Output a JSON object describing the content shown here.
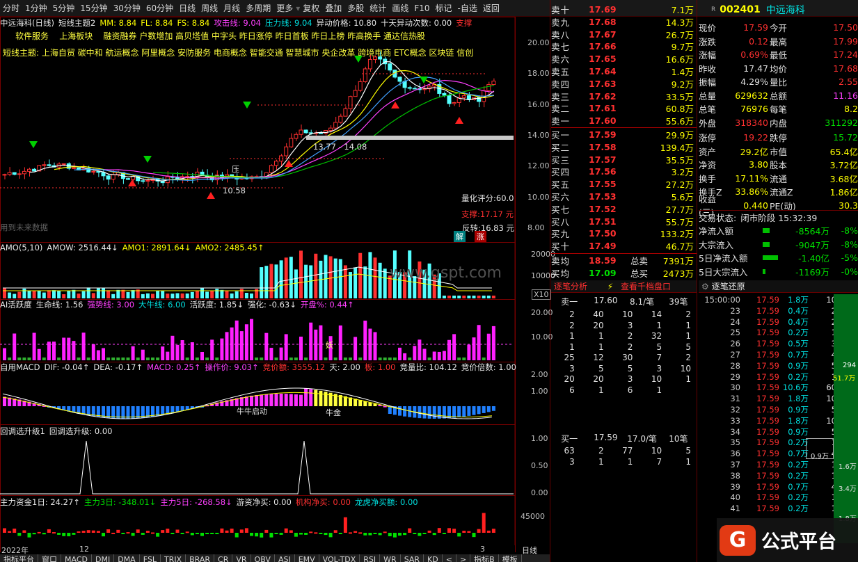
{
  "toolbar": [
    "分时",
    "1分钟",
    "5分钟",
    "15分钟",
    "30分钟",
    "60分钟",
    "日线",
    "周线",
    "月线",
    "多周期",
    "更多",
    "复权",
    "叠加",
    "多股",
    "统计",
    "画线",
    "F10",
    "标记",
    "-自选",
    "返回"
  ],
  "main_header": {
    "name": "中远海科(日线)",
    "ind": "短线主题2",
    "mm": "MM: 8.84",
    "fl": "FL: 8.84",
    "fs": "FS: 8.84",
    "gj": "攻击线: 9.04",
    "zj": "压力线: 9.04",
    "yd": "异动价格: 10.80",
    "ydcs": "十天异动次数: 0.00",
    "zc": "支撑"
  },
  "topics1": "软件服务    上海板块    融资融券 户数增加 高贝塔值 中字头 昨日涨停 昨日首板 昨日上榜 昨高换手 通达信热股",
  "topics2": "短线主题: 上海自贸 碳中和 航运概念 阿里概念 安防服务 电商概念 智能交通 智慧城市 央企改革 跨境电商 ETC概念 区块链 信创",
  "main_annot": {
    "range": "13.77 - 14.08",
    "low": "10.58",
    "score": "量化评分:60.0",
    "support": "支撑:17.17 元",
    "reverse": "反转:16.83 元",
    "future": "用到未来数据",
    "jie": "解",
    "zhang": "涨",
    "ya": "压"
  },
  "main_axis": [
    "20.00",
    "18.00",
    "16.00",
    "14.00",
    "12.00",
    "10.00",
    "8.00"
  ],
  "amo": {
    "t": "AMO(5,10)",
    "a": "AMOW: 2516.44↓",
    "b": "AMO1: 2891.64↓",
    "c": "AMO2: 2485.45↑",
    "axis": [
      "20000",
      "10000"
    ],
    "x10": "X10",
    "watermark": "www.gspt.com"
  },
  "ai": {
    "t": "AI活跃度",
    "a": "生命线: 1.56",
    "b": "强势线: 3.00",
    "c": "大牛线: 6.00",
    "d": "活跃度: 1.85↓",
    "e": "强化: -0.63↓",
    "f": "开盘%: 0.44↑",
    "axis": [
      "20.00",
      "10.00"
    ],
    "yao": "妖"
  },
  "macd": {
    "t": "自用MACD",
    "a": "DIF: -0.04↑",
    "b": "DEA: -0.17↑",
    "c": "MACD: 0.25↑",
    "d": "操作价: 9.03↑",
    "e": "竞价额: 3555.12",
    "f": "天: 2.00",
    "g": "板: 1.00",
    "h": "竞量比: 104.12",
    "i": "竞价倍数: 1.00",
    "axis": [
      "2.00",
      "1.00"
    ],
    "s1": "牛牛启动",
    "s2": "牛金"
  },
  "hd": {
    "t": "回调选升级1",
    "a": "回调选升级: 0.00",
    "axis": [
      "1.00",
      "0.50",
      "0.00"
    ]
  },
  "zl": {
    "t": "主力资金1日: 24.27↑",
    "a": "主力3日: -348.01↓",
    "b": "主力5日: -268.58↓",
    "c": "游资净买: 0.00",
    "d": "机构净买: 0.00",
    "e": "龙虎净买额: 0.00",
    "axis": [
      "45000"
    ]
  },
  "date_axis": {
    "year": "2022年",
    "m12": "12",
    "m3": "3",
    "period": "日线"
  },
  "bottom_tabs": [
    "指标平台",
    "窗口",
    "MACD",
    "DMI",
    "DMA",
    "FSL",
    "TRIX",
    "BRAR",
    "CR",
    "VR",
    "OBV",
    "ASI",
    "EMV",
    "VOL-TDX",
    "RSI",
    "WR",
    "SAR",
    "KD",
    "<",
    ">",
    "指标B",
    "模板"
  ],
  "stock": {
    "flag": "R",
    "code": "002401",
    "name": "中远海科"
  },
  "asks": [
    [
      "卖十",
      [
        "17.69"
      ],
      "7.1万"
    ],
    [
      "卖九",
      "17.68",
      "14.3万"
    ],
    [
      "卖八",
      "17.67",
      "26.7万"
    ],
    [
      "卖七",
      "17.66",
      "9.7万"
    ],
    [
      "卖六",
      "17.65",
      "16.6万"
    ],
    [
      "卖五",
      "17.64",
      "1.4万"
    ],
    [
      "卖四",
      "17.63",
      "9.2万"
    ],
    [
      "卖三",
      "17.62",
      "33.5万"
    ],
    [
      "卖二",
      "17.61",
      "60.8万"
    ],
    [
      "卖一",
      "17.60",
      "55.6万"
    ]
  ],
  "bids": [
    [
      "买一",
      "17.59",
      "29.9万"
    ],
    [
      "买二",
      "17.58",
      "139.4万"
    ],
    [
      "买三",
      "17.57",
      "35.5万"
    ],
    [
      "买四",
      "17.56",
      "3.2万"
    ],
    [
      "买五",
      "17.55",
      "27.2万"
    ],
    [
      "买六",
      "17.53",
      "5.6万"
    ],
    [
      "买七",
      "17.52",
      "27.7万"
    ],
    [
      "买八",
      "17.51",
      "55.7万"
    ],
    [
      "买九",
      "17.50",
      "133.2万"
    ],
    [
      "买十",
      "17.49",
      "46.7万"
    ]
  ],
  "avg": [
    [
      "卖均",
      "18.59",
      "总卖",
      "7391万"
    ],
    [
      "买均",
      "17.09",
      "总买",
      "2473万"
    ]
  ],
  "quote": [
    [
      "现价",
      "17.59",
      "今开",
      "17.50"
    ],
    [
      "涨跌",
      "0.12",
      "最高",
      "17.99"
    ],
    [
      "涨幅",
      "0.69%",
      "最低",
      "17.24"
    ],
    [
      "昨收",
      "17.47",
      "均价",
      "17.68"
    ],
    [
      "振幅",
      "4.29%",
      "量比",
      "2.55"
    ],
    [
      "总量",
      "629632",
      "总额",
      "11.16"
    ],
    [
      "总笔",
      "76976",
      "每笔",
      "8.2"
    ],
    [
      "外盘",
      "318340",
      "内盘",
      "311292"
    ],
    [
      "涨停",
      "19.22",
      "跌停",
      "15.72"
    ],
    [
      "资产",
      "29.2亿",
      "市值",
      "65.4亿"
    ],
    [
      "净资",
      "3.80",
      "股本",
      "3.72亿"
    ],
    [
      "换手",
      "17.11%",
      "流通",
      "3.68亿"
    ],
    [
      "换手Z",
      "33.86%",
      "流通Z",
      "1.86亿"
    ],
    [
      "收益(三)",
      "0.440",
      "PE(动)",
      "30.3"
    ]
  ],
  "status": {
    "lbl": "交易状态:",
    "val": "闭市阶段 15:32:39"
  },
  "flow": [
    [
      "净流入额",
      "-8564万",
      "-8%"
    ],
    [
      "大宗流入",
      "-9047万",
      "-8%"
    ],
    [
      "5日净流入额",
      "-1.40亿",
      "-5%"
    ],
    [
      "5日大宗流入",
      "-1169万",
      "-0%"
    ]
  ],
  "tabs_mid": {
    "a": "逐笔分析",
    "b": "查看千档盘口",
    "c": "逐笔还原"
  },
  "sell1": {
    "lbl": "卖一",
    "price": "17.60",
    "vol": "8.1/笔",
    "cnt": "39笔"
  },
  "sell_grid": [
    [
      "2",
      "40",
      "10",
      "14",
      "2"
    ],
    [
      "2",
      "20",
      "3",
      "1",
      "1"
    ],
    [
      "1",
      "1",
      "2",
      "32",
      "1"
    ],
    [
      "1",
      "1",
      "2",
      "5",
      "5"
    ],
    [
      "25",
      "12",
      "30",
      "7",
      "2"
    ],
    [
      "3",
      "5",
      "5",
      "3",
      "10"
    ],
    [
      "20",
      "20",
      "3",
      "10",
      "1"
    ],
    [
      "6",
      "1",
      "6",
      "1",
      ""
    ]
  ],
  "buy1": {
    "lbl": "买一",
    "price": "17.59",
    "vol": "17.0/笔",
    "cnt": "10笔"
  },
  "buy_grid": [
    [
      "63",
      "2",
      "77",
      "10",
      "5"
    ],
    [
      "3",
      "1",
      "1",
      "7",
      "1"
    ]
  ],
  "ticks": [
    [
      "15:00:00",
      "17.59",
      "1.8万",
      "10"
    ],
    [
      "23",
      "17.59",
      "0.4万",
      "2"
    ],
    [
      "24",
      "17.59",
      "0.4万",
      "2"
    ],
    [
      "25",
      "17.59",
      "0.2万",
      "1"
    ],
    [
      "26",
      "17.59",
      "0.5万",
      "3"
    ],
    [
      "27",
      "17.59",
      "0.7万",
      "4"
    ],
    [
      "28",
      "17.59",
      "0.9万",
      "5"
    ],
    [
      "29",
      "17.59",
      "0.2万",
      "1"
    ],
    [
      "30",
      "17.59",
      "10.6万",
      "60"
    ],
    [
      "31",
      "17.59",
      "1.8万",
      "10"
    ],
    [
      "32",
      "17.59",
      "0.9万",
      "5"
    ],
    [
      "33",
      "17.59",
      "1.8万",
      "10"
    ],
    [
      "34",
      "17.59",
      "0.9万",
      "5"
    ],
    [
      "35",
      "17.59",
      "0.2万",
      "1"
    ],
    [
      "36",
      "17.59",
      "0.7万",
      "4"
    ],
    [
      "37",
      "17.59",
      "0.2万",
      "1"
    ],
    [
      "38",
      "17.59",
      "0.2万",
      "1"
    ],
    [
      "39",
      "17.59",
      "0.7万",
      "4"
    ],
    [
      "40",
      "17.59",
      "0.2万",
      "1"
    ],
    [
      "41",
      "17.59",
      "0.2万",
      "1"
    ]
  ],
  "depth_labels": {
    "a": "294",
    "b": "51.7万",
    "c": "0.9万",
    "d": "1.6万",
    "e": "3.4万",
    "f": "1.8万"
  },
  "logo": "公式平台"
}
